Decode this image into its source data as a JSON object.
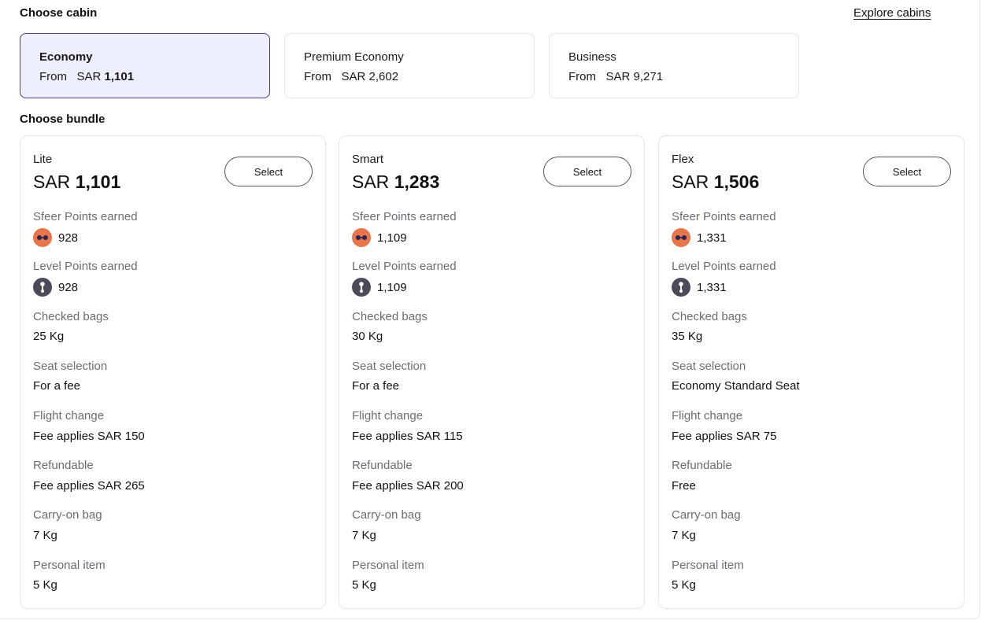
{
  "cabin_section": {
    "title": "Choose cabin",
    "explore_link": "Explore cabins",
    "cabins": [
      {
        "name": "Economy",
        "from": "From",
        "currency": "SAR",
        "amount": "1,101",
        "selected": true
      },
      {
        "name": "Premium Economy",
        "from": "From",
        "currency": "SAR",
        "amount": "2,602",
        "selected": false
      },
      {
        "name": "Business",
        "from": "From",
        "currency": "SAR",
        "amount": "9,271",
        "selected": false
      }
    ]
  },
  "bundle_section": {
    "title": "Choose bundle",
    "labels": {
      "sfeer": "Sfeer Points earned",
      "level": "Level Points earned",
      "checked": "Checked bags",
      "seat": "Seat selection",
      "change": "Flight change",
      "refund": "Refundable",
      "carry": "Carry-on bag",
      "personal": "Personal item"
    },
    "select_label": "Select",
    "bundles": [
      {
        "name": "Lite",
        "currency": "SAR",
        "amount": "1,101",
        "sfeer": "928",
        "level": "928",
        "checked": "25 Kg",
        "seat": "For a fee",
        "change": "Fee applies SAR 150",
        "refund": "Fee applies SAR 265",
        "carry": "7 Kg",
        "personal": "5 Kg"
      },
      {
        "name": "Smart",
        "currency": "SAR",
        "amount": "1,283",
        "sfeer": "1,109",
        "level": "1,109",
        "checked": "30 Kg",
        "seat": "For a fee",
        "change": "Fee applies SAR 115",
        "refund": "Fee applies SAR 200",
        "carry": "7 Kg",
        "personal": "5 Kg"
      },
      {
        "name": "Flex",
        "currency": "SAR",
        "amount": "1,506",
        "sfeer": "1,331",
        "level": "1,331",
        "checked": "35 Kg",
        "seat": "Economy Standard Seat",
        "change": "Fee applies SAR 75",
        "refund": "Free",
        "carry": "7 Kg",
        "personal": "5 Kg"
      }
    ]
  },
  "icons": {
    "sfeer": "sfeer-points-icon",
    "level": "level-points-icon"
  },
  "colors": {
    "selected_bg": "#eeeffc",
    "selected_border": "#4a3f8c",
    "sfeer_icon": "#e8744a",
    "level_icon": "#4b4a58"
  }
}
